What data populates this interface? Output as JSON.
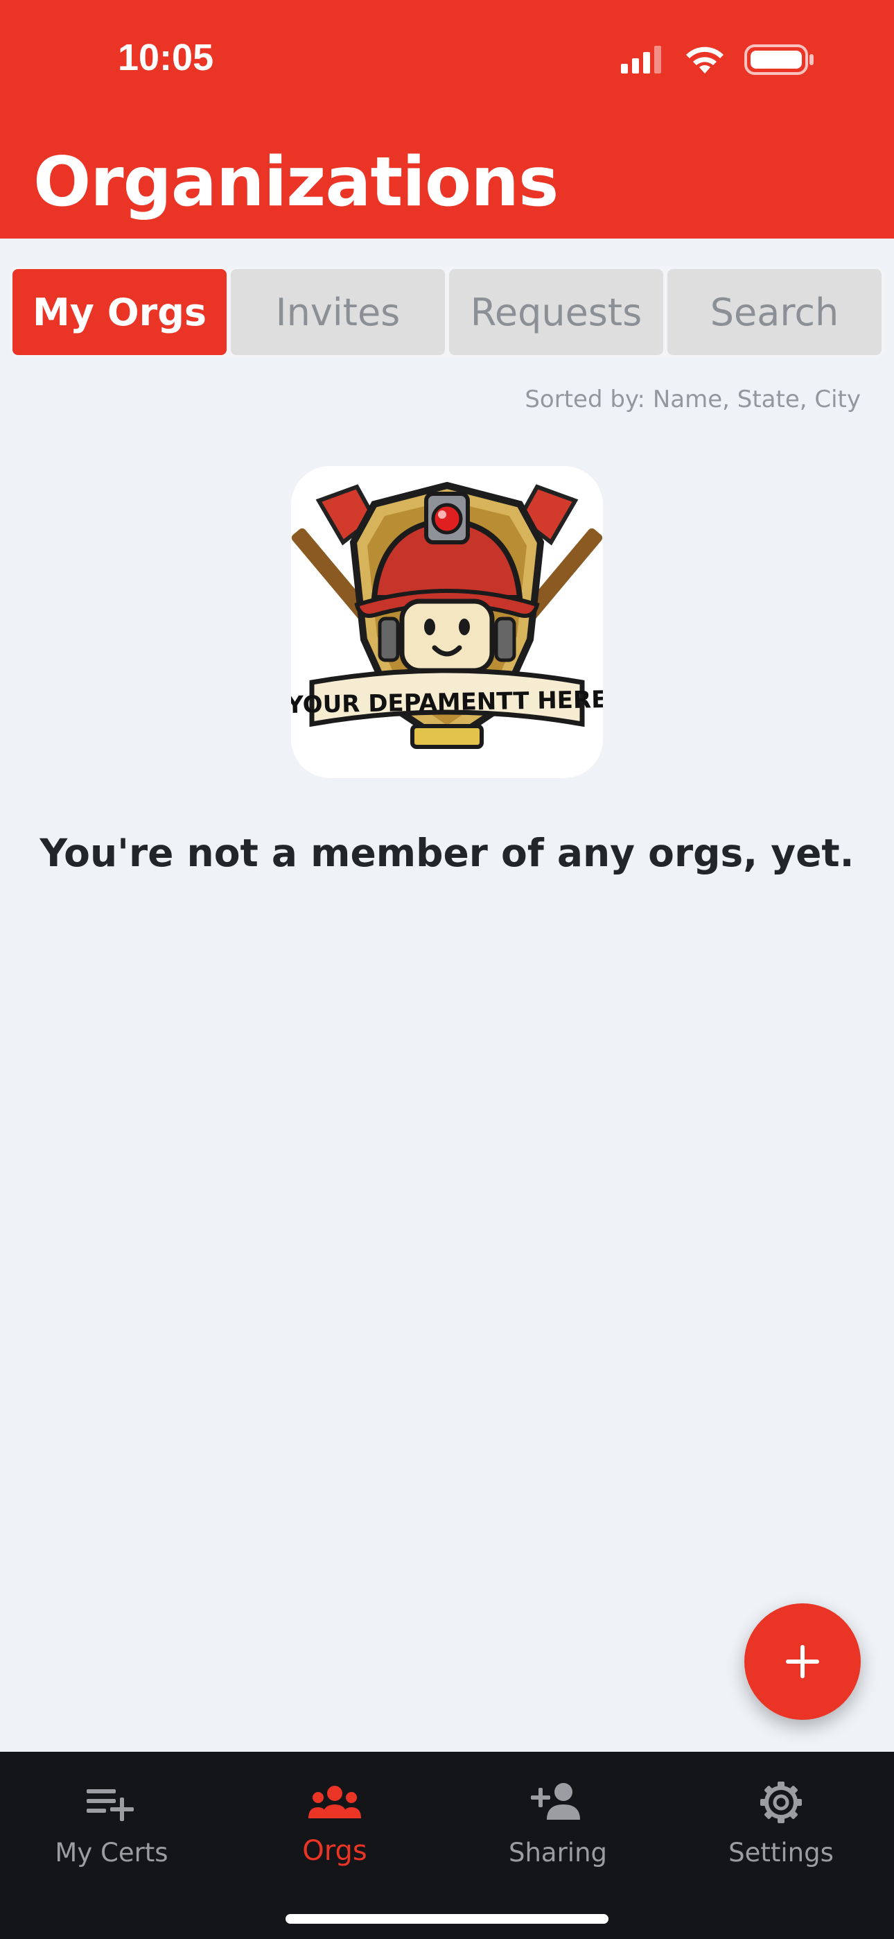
{
  "status_bar": {
    "time": "10:05",
    "icons": [
      "cellular-signal-icon",
      "wifi-icon",
      "battery-icon"
    ]
  },
  "header": {
    "title": "Organizations",
    "background_color": "#ea3425"
  },
  "segmented_control": {
    "tabs": [
      {
        "label": "My Orgs",
        "active": true
      },
      {
        "label": "Invites",
        "active": false
      },
      {
        "label": "Requests",
        "active": false
      },
      {
        "label": "Search",
        "active": false
      }
    ],
    "active_color": "#ea3425"
  },
  "sort_text": "Sorted by: Name, State, City",
  "empty_state": {
    "badge_text": "YOUR DEPAMENTT HERE",
    "message": "You're not a member of any orgs, yet."
  },
  "fab": {
    "icon": "plus-icon",
    "color": "#ea3425"
  },
  "bottom_nav": {
    "items": [
      {
        "label": "My Certs",
        "icon": "playlist-add-icon",
        "active": false
      },
      {
        "label": "Orgs",
        "icon": "groups-icon",
        "active": true
      },
      {
        "label": "Sharing",
        "icon": "person-add-icon",
        "active": false
      },
      {
        "label": "Settings",
        "icon": "gear-icon",
        "active": false
      }
    ],
    "active_color": "#ea3425",
    "inactive_color": "#9b9da2"
  }
}
